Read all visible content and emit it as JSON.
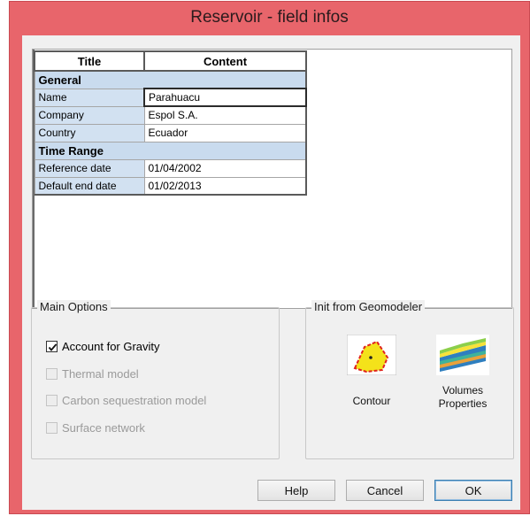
{
  "window": {
    "title": "Reservoir - field infos"
  },
  "table": {
    "headers": [
      "Title",
      "Content"
    ],
    "groups": [
      {
        "name": "General",
        "rows": [
          {
            "title": "Name",
            "content": "Parahuacu"
          },
          {
            "title": "Company",
            "content": "Espol S.A."
          },
          {
            "title": "Country",
            "content": "Ecuador"
          }
        ]
      },
      {
        "name": "Time Range",
        "rows": [
          {
            "title": "Reference date",
            "content": "01/04/2002"
          },
          {
            "title": "Default end date",
            "content": "01/02/2013"
          }
        ]
      }
    ]
  },
  "main_options": {
    "label": "Main Options",
    "items": [
      {
        "label": "Account for Gravity",
        "checked": true,
        "enabled": true
      },
      {
        "label": "Thermal model",
        "checked": false,
        "enabled": false
      },
      {
        "label": "Carbon sequestration model",
        "checked": false,
        "enabled": false
      },
      {
        "label": "Surface network",
        "checked": false,
        "enabled": false
      }
    ]
  },
  "init_geomodeler": {
    "label": "Init from Geomodeler",
    "contour_label": "Contour",
    "volumes_label_line1": "Volumes",
    "volumes_label_line2": "Properties",
    "contour_icon": "contour-polygon-icon",
    "volumes_icon": "volume-layers-icon"
  },
  "buttons": {
    "help": "Help",
    "cancel": "Cancel",
    "ok": "OK"
  },
  "colors": {
    "titlebar": "#e8656b",
    "group_row": "#c9dbee",
    "label_cell": "#d2e1f1"
  }
}
